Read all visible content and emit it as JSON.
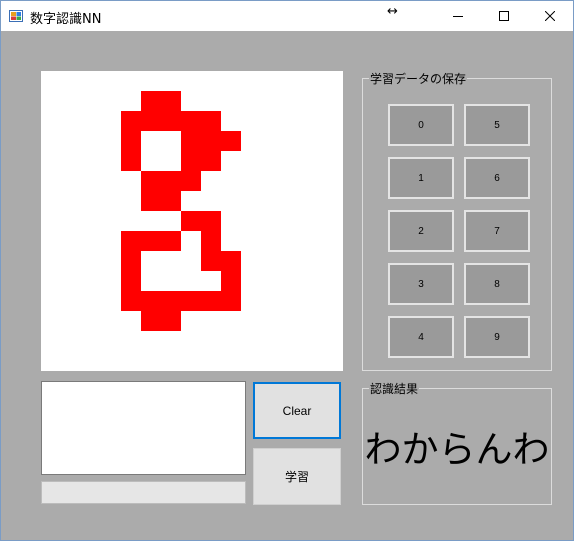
{
  "window": {
    "title": "数字認識NN",
    "resize_cursor": "↔"
  },
  "icons": {
    "app": "app-icon",
    "minimize": "minimize-icon",
    "maximize": "maximize-icon",
    "close": "close-icon"
  },
  "colors": {
    "window_bg": "#ababab",
    "stroke": "#ff0000",
    "digit_button_bg": "#9a9a9a",
    "clear_focus_border": "#0078d7"
  },
  "save_group": {
    "label": "学習データの保存",
    "buttons": [
      "0",
      "5",
      "1",
      "6",
      "2",
      "7",
      "3",
      "8",
      "4",
      "9"
    ]
  },
  "result_group": {
    "label": "認識結果",
    "value": "わからんわ"
  },
  "text_box": {
    "value": ""
  },
  "progress": {
    "value": 0
  },
  "actions": {
    "clear_label": "Clear",
    "learn_label": "学習"
  }
}
